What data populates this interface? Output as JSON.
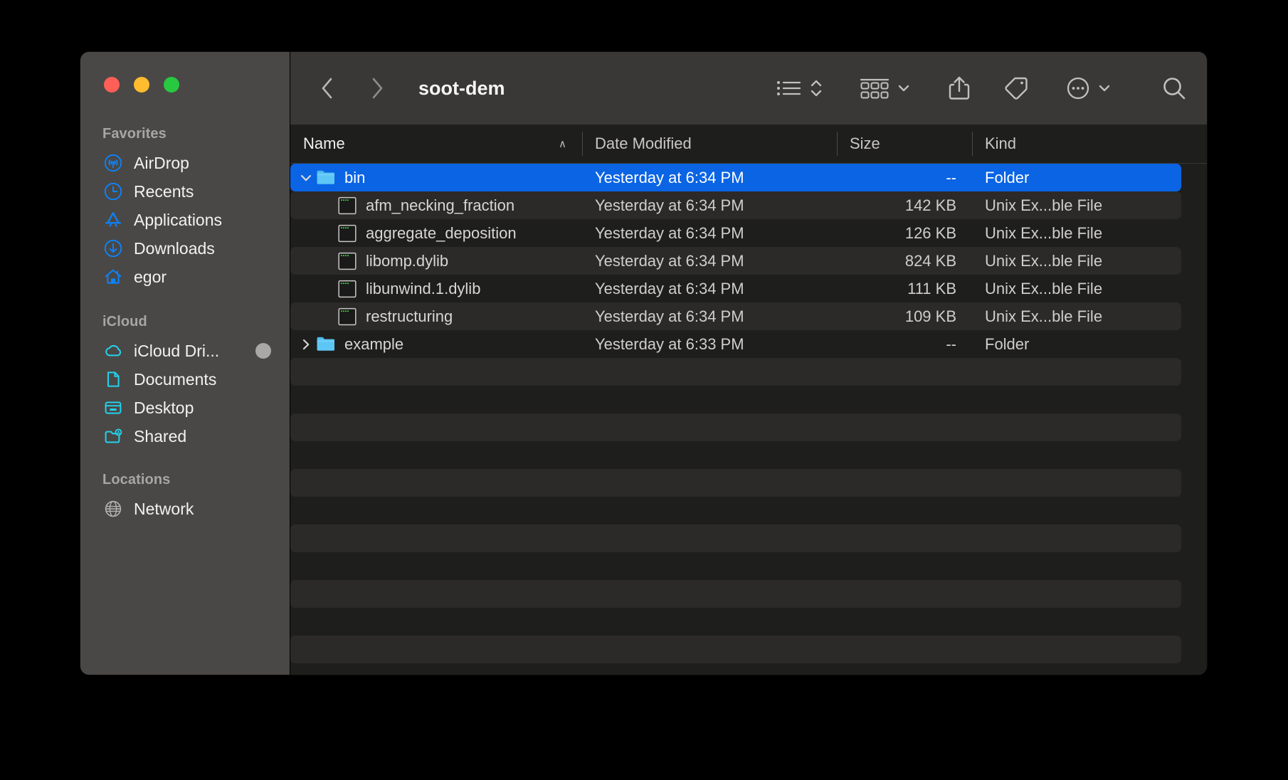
{
  "window": {
    "title": "soot-dem",
    "traffic_lights": [
      {
        "name": "close",
        "color": "#ff5f57"
      },
      {
        "name": "minimize",
        "color": "#febc2e"
      },
      {
        "name": "zoom",
        "color": "#28c840"
      }
    ]
  },
  "toolbar": {
    "back_icon": "chevron-left-icon",
    "forward_icon": "chevron-right-icon",
    "title": "soot-dem",
    "view_icon": "list-view-icon",
    "view_sort_icon": "up-down-chevron-icon",
    "group_icon": "group-by-icon",
    "group_chevron_icon": "chevron-down-icon",
    "share_icon": "share-icon",
    "tag_icon": "tag-icon",
    "more_icon": "ellipsis-circle-icon",
    "more_chevron_icon": "chevron-down-icon",
    "search_icon": "search-icon"
  },
  "sidebar": {
    "sections": [
      {
        "title": "Favorites",
        "items": [
          {
            "label": "AirDrop",
            "icon": "airdrop-icon",
            "color": "#0a84ff"
          },
          {
            "label": "Recents",
            "icon": "clock-icon",
            "color": "#0a84ff"
          },
          {
            "label": "Applications",
            "icon": "applications-icon",
            "color": "#0a84ff"
          },
          {
            "label": "Downloads",
            "icon": "downloads-icon",
            "color": "#0a84ff"
          },
          {
            "label": "egor",
            "icon": "home-icon",
            "color": "#0a84ff"
          }
        ]
      },
      {
        "title": "iCloud",
        "items": [
          {
            "label": "iCloud Dri...",
            "icon": "cloud-icon",
            "color": "#22d3ee",
            "badge": true
          },
          {
            "label": "Documents",
            "icon": "document-icon",
            "color": "#22d3ee"
          },
          {
            "label": "Desktop",
            "icon": "desktop-icon",
            "color": "#22d3ee"
          },
          {
            "label": "Shared",
            "icon": "shared-folder-icon",
            "color": "#22d3ee"
          }
        ]
      },
      {
        "title": "Locations",
        "items": [
          {
            "label": "Network",
            "icon": "globe-icon",
            "color": "#b6b4b2"
          }
        ]
      }
    ]
  },
  "file_browser": {
    "columns": [
      {
        "key": "name",
        "label": "Name",
        "sorted": true,
        "sort_caret": "∧"
      },
      {
        "key": "date",
        "label": "Date Modified",
        "sorted": false
      },
      {
        "key": "size",
        "label": "Size",
        "sorted": false
      },
      {
        "key": "kind",
        "label": "Kind",
        "sorted": false
      }
    ],
    "rows": [
      {
        "name": "bin",
        "date": "Yesterday at 6:34 PM",
        "size": "--",
        "kind": "Folder",
        "icon": "folder-icon",
        "disclosure": "expanded",
        "indent": 0,
        "selected": true
      },
      {
        "name": "afm_necking_fraction",
        "date": "Yesterday at 6:34 PM",
        "size": "142 KB",
        "kind": "Unix Ex...ble File",
        "icon": "unix-executable-icon",
        "disclosure": "none",
        "indent": 1,
        "selected": false
      },
      {
        "name": "aggregate_deposition",
        "date": "Yesterday at 6:34 PM",
        "size": "126 KB",
        "kind": "Unix Ex...ble File",
        "icon": "unix-executable-icon",
        "disclosure": "none",
        "indent": 1,
        "selected": false
      },
      {
        "name": "libomp.dylib",
        "date": "Yesterday at 6:34 PM",
        "size": "824 KB",
        "kind": "Unix Ex...ble File",
        "icon": "unix-executable-icon",
        "disclosure": "none",
        "indent": 1,
        "selected": false
      },
      {
        "name": "libunwind.1.dylib",
        "date": "Yesterday at 6:34 PM",
        "size": "111 KB",
        "kind": "Unix Ex...ble File",
        "icon": "unix-executable-icon",
        "disclosure": "none",
        "indent": 1,
        "selected": false
      },
      {
        "name": "restructuring",
        "date": "Yesterday at 6:34 PM",
        "size": "109 KB",
        "kind": "Unix Ex...ble File",
        "icon": "unix-executable-icon",
        "disclosure": "none",
        "indent": 1,
        "selected": false
      },
      {
        "name": "example",
        "date": "Yesterday at 6:33 PM",
        "size": "--",
        "kind": "Folder",
        "icon": "folder-icon",
        "disclosure": "collapsed",
        "indent": 0,
        "selected": false
      }
    ],
    "empty_row_count": 12
  },
  "colors": {
    "selection": "#0a64e4",
    "sidebar_bg": "#4a4846",
    "content_bg": "#1e1e1c",
    "toolbar_bg": "#3a3836",
    "row_alt": "#2b2a28",
    "accent_blue": "#0a84ff",
    "accent_cyan": "#22d3ee"
  }
}
